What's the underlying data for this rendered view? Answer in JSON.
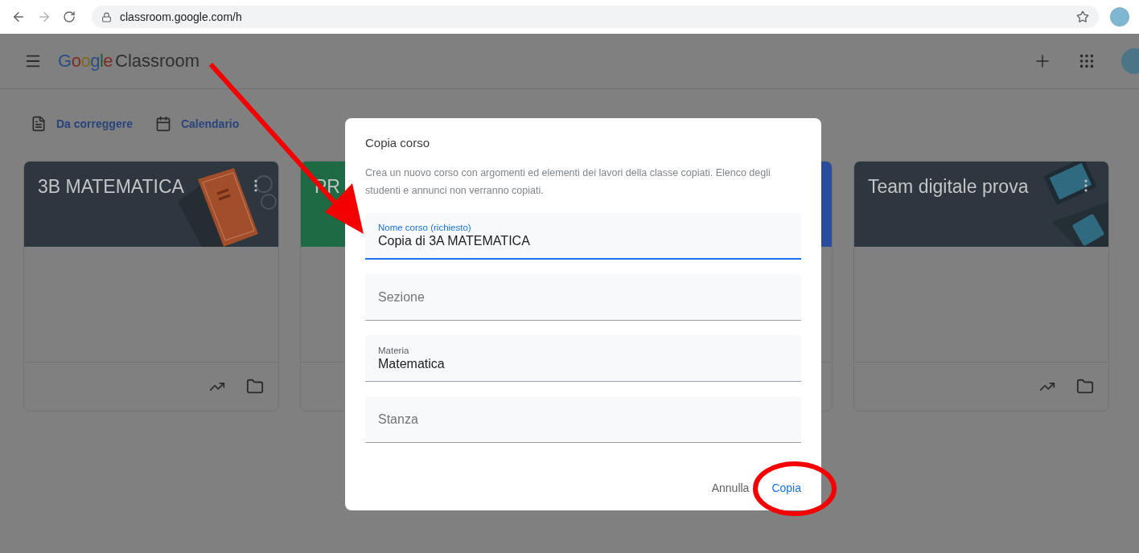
{
  "browser": {
    "url": "classroom.google.com/h"
  },
  "app_bar": {
    "logo_google": "Google",
    "logo_product": "Classroom"
  },
  "nav": [
    {
      "label": "Da correggere",
      "kind": "todo"
    },
    {
      "label": "Calendario",
      "kind": "calendar"
    }
  ],
  "cards": [
    {
      "title": "3B MATEMATICA",
      "color": "#2e373f",
      "kind": "book"
    },
    {
      "title": "PR",
      "color": "#1d6a44",
      "kind": "plain"
    },
    {
      "color": "#2a4c9c",
      "kind": "plain"
    },
    {
      "title": "Team digitale prova",
      "color": "#2e373f",
      "kind": "tablets"
    }
  ],
  "dialog": {
    "title": "Copia corso",
    "description": "Crea un nuovo corso con argomenti ed elementi dei lavori della classe copiati. Elenco degli studenti e annunci non verranno copiati.",
    "fields": [
      {
        "label": "Nome corso (richiesto)",
        "value": "Copia di 3A MATEMATICA",
        "focused": true
      },
      {
        "placeholder": "Sezione",
        "focused": false
      },
      {
        "label": "Materia",
        "value": "Matematica",
        "focused": false
      },
      {
        "placeholder": "Stanza",
        "focused": false
      }
    ],
    "actions": [
      {
        "label": "Annulla",
        "kind": "cancel"
      },
      {
        "label": "Copia",
        "kind": "confirm"
      }
    ]
  }
}
